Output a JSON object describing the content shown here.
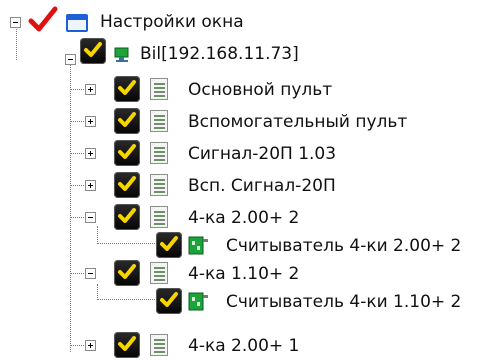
{
  "tree": {
    "root": {
      "label": "Настройки окна"
    },
    "server": {
      "label": "Bil[192.168.11.73]"
    },
    "items": [
      {
        "label": "Основной пульт"
      },
      {
        "label": "Вспомогательный пульт"
      },
      {
        "label": "Сигнал-20П 1.03"
      },
      {
        "label": "Всп. Сигнал-20П"
      },
      {
        "label": "4-ка 2.00+ 2"
      },
      {
        "label": "Считыватель 4-ки 2.00+ 2"
      },
      {
        "label": "4-ка 1.10+ 2"
      },
      {
        "label": "Считыватель 4-ки 1.10+ 2"
      },
      {
        "label": "4-ка 2.00+ 1"
      }
    ]
  },
  "colors": {
    "checkmark": "#f5d400",
    "root_check": "#e01010",
    "window_icon": "#1f5fd6",
    "card_green": "#1aa43a"
  }
}
